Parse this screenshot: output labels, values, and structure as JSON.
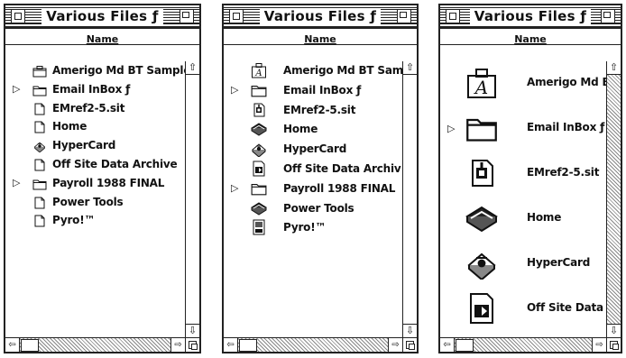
{
  "windows": [
    {
      "title": "Various Files ƒ",
      "column_header": "Name",
      "view": "small-icon",
      "items": [
        {
          "label": "Amerigo Md BT Sample",
          "icon": "suitcase-icon",
          "expandable": false
        },
        {
          "label": "Email InBox ƒ",
          "icon": "folder-icon",
          "expandable": true
        },
        {
          "label": "EMref2-5.sit",
          "icon": "document-icon",
          "expandable": false
        },
        {
          "label": "Home",
          "icon": "document-icon",
          "expandable": false
        },
        {
          "label": "HyperCard",
          "icon": "hypercard-app-icon",
          "expandable": false
        },
        {
          "label": "Off Site Data Archive",
          "icon": "document-icon",
          "expandable": false
        },
        {
          "label": "Payroll 1988 FINAL",
          "icon": "folder-icon",
          "expandable": true
        },
        {
          "label": "Power Tools",
          "icon": "document-icon",
          "expandable": false
        },
        {
          "label": "Pyro!™",
          "icon": "document-icon",
          "expandable": false
        }
      ]
    },
    {
      "title": "Various Files ƒ",
      "column_header": "Name",
      "view": "medium-icon",
      "items": [
        {
          "label": "Amerigo Md BT Sam",
          "icon": "font-suitcase-icon",
          "expandable": false
        },
        {
          "label": "Email InBox ƒ",
          "icon": "folder-icon",
          "expandable": true
        },
        {
          "label": "EMref2-5.sit",
          "icon": "stuffit-archive-icon",
          "expandable": false
        },
        {
          "label": "Home",
          "icon": "hypercard-stack-icon",
          "expandable": false
        },
        {
          "label": "HyperCard",
          "icon": "hypercard-app-icon",
          "expandable": false
        },
        {
          "label": "Off Site Data Archiv",
          "icon": "archive-document-icon",
          "expandable": false
        },
        {
          "label": "Payroll 1988 FINAL",
          "icon": "folder-icon",
          "expandable": true
        },
        {
          "label": "Power Tools",
          "icon": "hypercard-stack-icon",
          "expandable": false
        },
        {
          "label": "Pyro!™",
          "icon": "control-panel-icon",
          "expandable": false
        }
      ]
    },
    {
      "title": "Various Files ƒ",
      "column_header": "Name",
      "view": "large-icon",
      "items": [
        {
          "label": "Amerigo Md BT",
          "icon": "font-suitcase-icon",
          "expandable": false
        },
        {
          "label": "Email InBox ƒ",
          "icon": "folder-icon",
          "expandable": true
        },
        {
          "label": "EMref2-5.sit",
          "icon": "stuffit-archive-icon",
          "expandable": false
        },
        {
          "label": "Home",
          "icon": "hypercard-stack-icon",
          "expandable": false
        },
        {
          "label": "HyperCard",
          "icon": "hypercard-app-icon",
          "expandable": false
        },
        {
          "label": "Off Site Data A",
          "icon": "archive-document-icon",
          "expandable": false
        }
      ]
    }
  ],
  "scroll_glyphs": {
    "up": "⇧",
    "down": "⇩",
    "left": "⇦",
    "right": "⇨"
  }
}
